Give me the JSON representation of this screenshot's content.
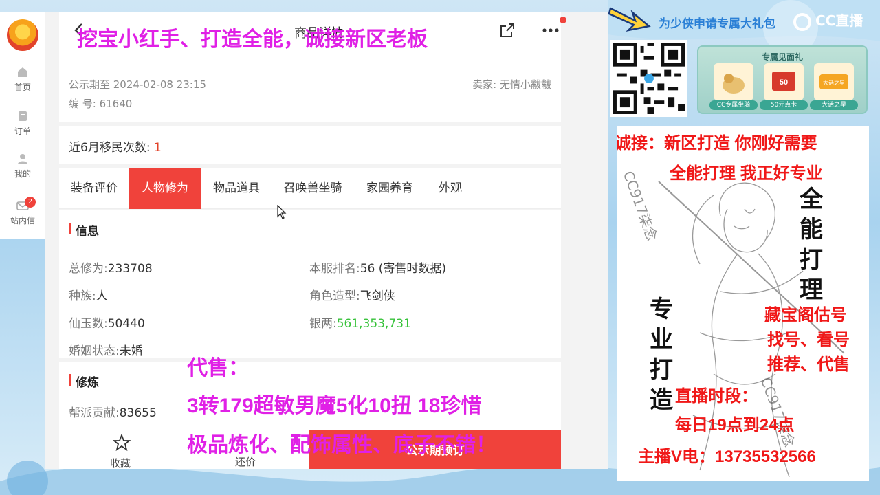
{
  "nav": {
    "items": [
      {
        "label": "首页"
      },
      {
        "label": "订单"
      },
      {
        "label": "我的"
      },
      {
        "label": "站内信",
        "badge": "2"
      }
    ]
  },
  "header": {
    "title": "商品详情"
  },
  "meta": {
    "date": "公示期至 2024-02-08 23:15",
    "seller": "卖家: 无情小黻黻",
    "number": "编 号: 61640"
  },
  "migrate": {
    "label": "近6月移民次数:",
    "value": "1"
  },
  "tabs": [
    {
      "label": "装备评价"
    },
    {
      "label": "人物修为",
      "active": true
    },
    {
      "label": "物品道具"
    },
    {
      "label": "召唤兽坐骑"
    },
    {
      "label": "家园养育"
    },
    {
      "label": "外观"
    }
  ],
  "info": {
    "title": "信息",
    "fields": [
      {
        "label": "总修为:",
        "value": "233708"
      },
      {
        "label": "本服排名:",
        "value": "56 (寄售时数据)"
      },
      {
        "label": "种族:",
        "value": "人"
      },
      {
        "label": "角色造型:",
        "value": "飞剑侠"
      },
      {
        "label": "仙玉数:",
        "value": "50440"
      },
      {
        "label": "银两:",
        "value": "561,353,731"
      },
      {
        "label": "婚姻状态:",
        "value": "未婚"
      }
    ]
  },
  "cultivation": {
    "title": "修炼",
    "fields": [
      {
        "label": "帮派贡献:",
        "value": "83655"
      }
    ]
  },
  "bottom": {
    "fav_label": "收藏",
    "bargain_label": "还价",
    "buy_label": "公示期预订"
  },
  "overlay": {
    "top": "挖宝小红手、打造全能，诚接新区老板",
    "sell_title": "代售：",
    "sell_line1": "3转179超敏男魔5化10扭  18珍惜",
    "sell_line2": "极品炼化、配饰属性、底子不错！"
  },
  "promo": {
    "banner": "为少侠申请专属大礼包",
    "cc_logo": "CC直播",
    "gift_title": "专属见面礼",
    "gifts": [
      "CC专属坐骑",
      "50元点卡",
      "大话之星"
    ],
    "gift_badge_1": "50",
    "gift_badge_2": "大话之星"
  },
  "poster": {
    "line1": "诚接：新区打造   你刚好需要",
    "line2": "全能打理   我正好专业",
    "vert_right": "全能打理",
    "vert_left": "专业打造",
    "services1": "藏宝阁估号",
    "services2": "找号、看号",
    "services3": "推荐、代售",
    "hours_title": "直播时段：",
    "hours": "每日19点到24点",
    "contact": "主播V电：13735532566",
    "watermark1": "CC917柒念",
    "watermark2": "CC917柒念"
  },
  "colors": {
    "accent": "#f0423b",
    "overlay": "#e020e6",
    "poster_red": "#f01818",
    "silver": "#37c23a"
  }
}
